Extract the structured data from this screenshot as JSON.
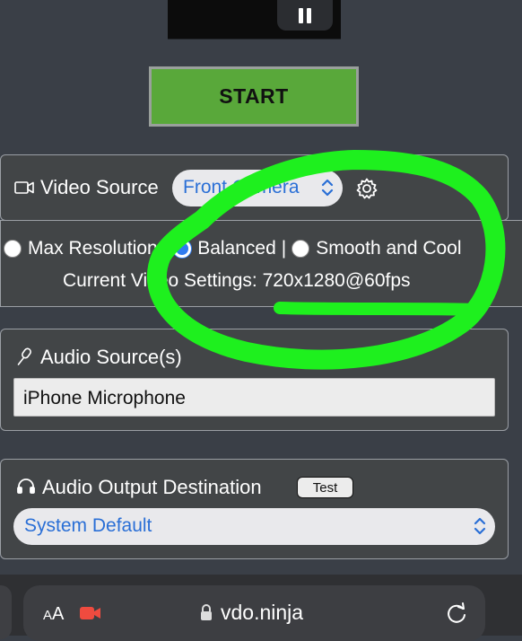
{
  "start_button": {
    "label": "START"
  },
  "video_source": {
    "label": "Video Source",
    "selected": "Front Camera",
    "camera_icon": "video-camera-icon",
    "settings_icon": "gear-icon"
  },
  "resolution": {
    "options": [
      {
        "label": "Max Resolution",
        "selected": false
      },
      {
        "label": "Balanced",
        "selected": true
      },
      {
        "label": "Smooth and Cool",
        "selected": false
      }
    ],
    "separator": "|",
    "current_settings": "Current Video Settings: 720x1280@60fps"
  },
  "audio_source": {
    "label": "Audio Source(s)",
    "icon": "microphone-icon",
    "value": "iPhone Microphone"
  },
  "audio_output": {
    "label": "Audio Output Destination",
    "icon": "headphones-icon",
    "test_label": "Test",
    "selected": "System Default"
  },
  "browser_bar": {
    "text_size_label": "A",
    "text_size_label_large": "A",
    "domain": "vdo.ninja",
    "lock_icon": "lock-icon",
    "reload_icon": "reload-icon",
    "recording_icon": "camera-recording-icon"
  },
  "colors": {
    "background": "#3a3f47",
    "start_green": "#59a83a",
    "link_blue": "#2a6fd6",
    "annotation_green": "#1ef01e",
    "recording_red": "#ef4b3f"
  }
}
